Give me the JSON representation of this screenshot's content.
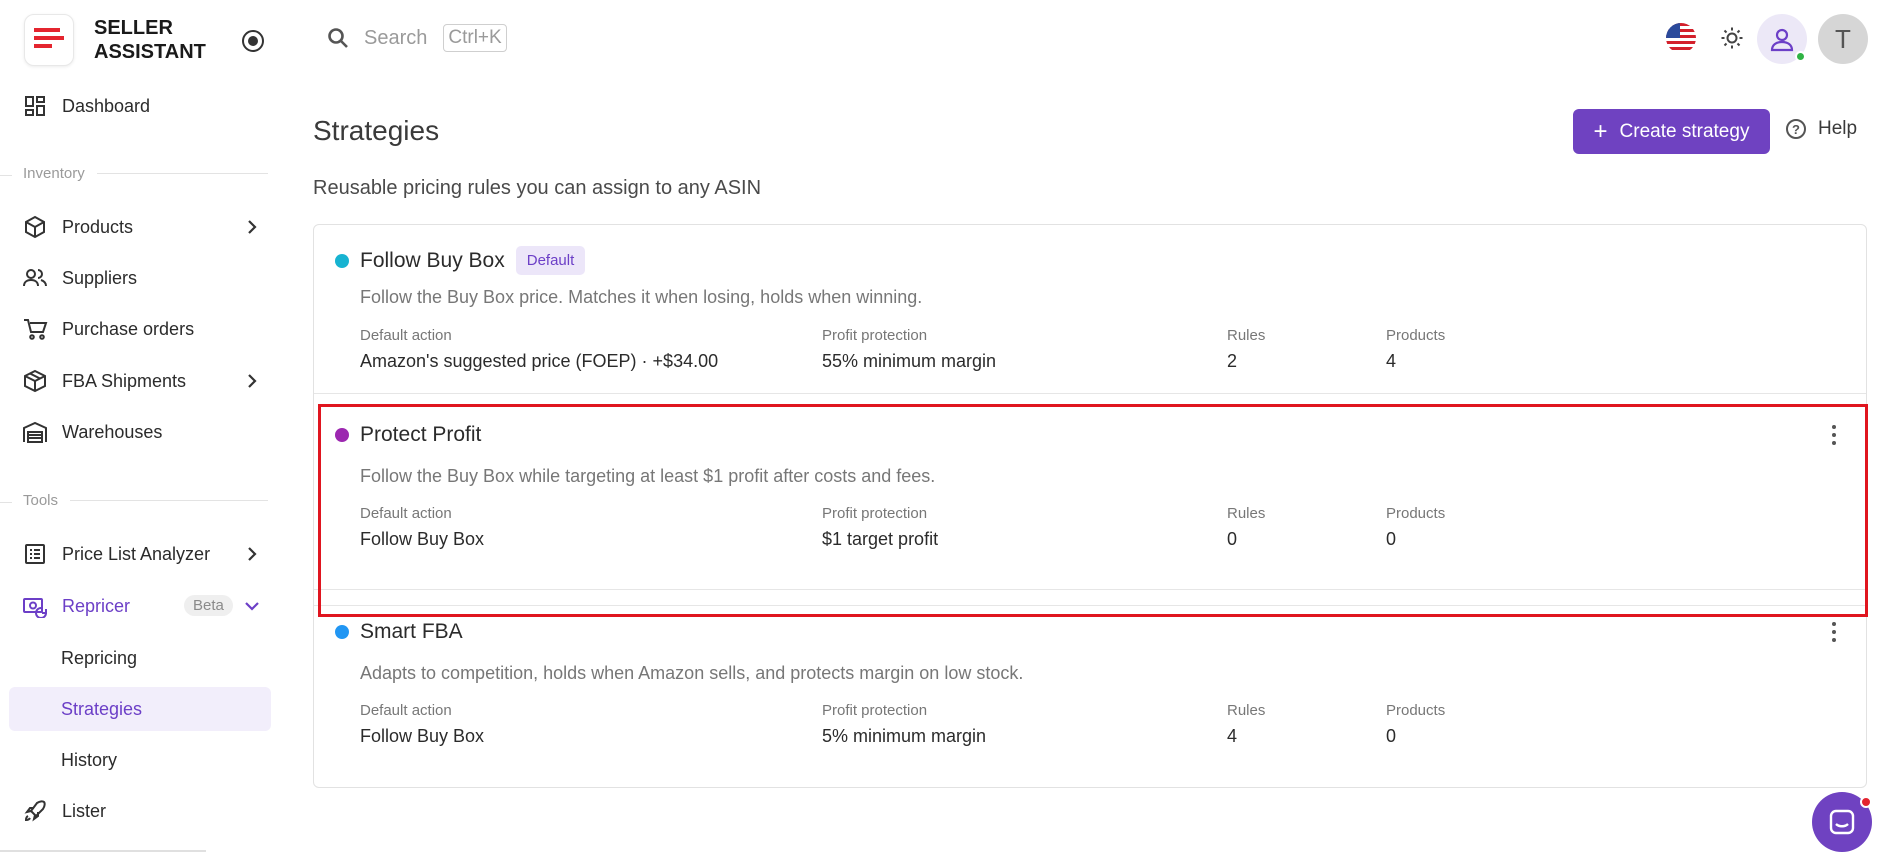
{
  "brand": {
    "name": "SELLER\nASSISTANT"
  },
  "search": {
    "placeholder": "Search",
    "shortcut": "Ctrl+K"
  },
  "sidebar": {
    "dashboard": "Dashboard",
    "inventory_label": "Inventory",
    "products": "Products",
    "suppliers": "Suppliers",
    "purchase_orders": "Purchase orders",
    "fba_shipments": "FBA Shipments",
    "warehouses": "Warehouses",
    "tools_label": "Tools",
    "price_list_analyzer": "Price List Analyzer",
    "repricer": "Repricer",
    "repricer_badge": "Beta",
    "repricing": "Repricing",
    "strategies": "Strategies",
    "history": "History",
    "lister": "Lister"
  },
  "header": {
    "avatar_initial": "T"
  },
  "page": {
    "title": "Strategies",
    "subtitle": "Reusable pricing rules you can assign to any ASIN",
    "create_label": "Create strategy",
    "help_label": "Help"
  },
  "labels": {
    "default_action": "Default action",
    "profit_protection": "Profit protection",
    "rules": "Rules",
    "products": "Products"
  },
  "strategies": [
    {
      "name": "Follow Buy Box",
      "badge": "Default",
      "color": "#17b3d1",
      "description": "Follow the Buy Box price. Matches it when losing, holds when winning.",
      "default_action": "Amazon's suggested price (FOEP) · +$34.00",
      "profit_protection": "55% minimum margin",
      "rules": "2",
      "products": "4"
    },
    {
      "name": "Protect Profit",
      "color": "#9c27b0",
      "description": "Follow the Buy Box while targeting at least $1 profit after costs and fees.",
      "default_action": "Follow Buy Box",
      "profit_protection": "$1 target profit",
      "rules": "0",
      "products": "0"
    },
    {
      "name": "Smart FBA",
      "color": "#2196f3",
      "description": "Adapts to competition, holds when Amazon sells, and protects margin on low stock.",
      "default_action": "Follow Buy Box",
      "profit_protection": "5% minimum margin",
      "rules": "4",
      "products": "0"
    }
  ],
  "colors": {
    "accent": "#6f42c1",
    "highlight": "#e0151f"
  }
}
